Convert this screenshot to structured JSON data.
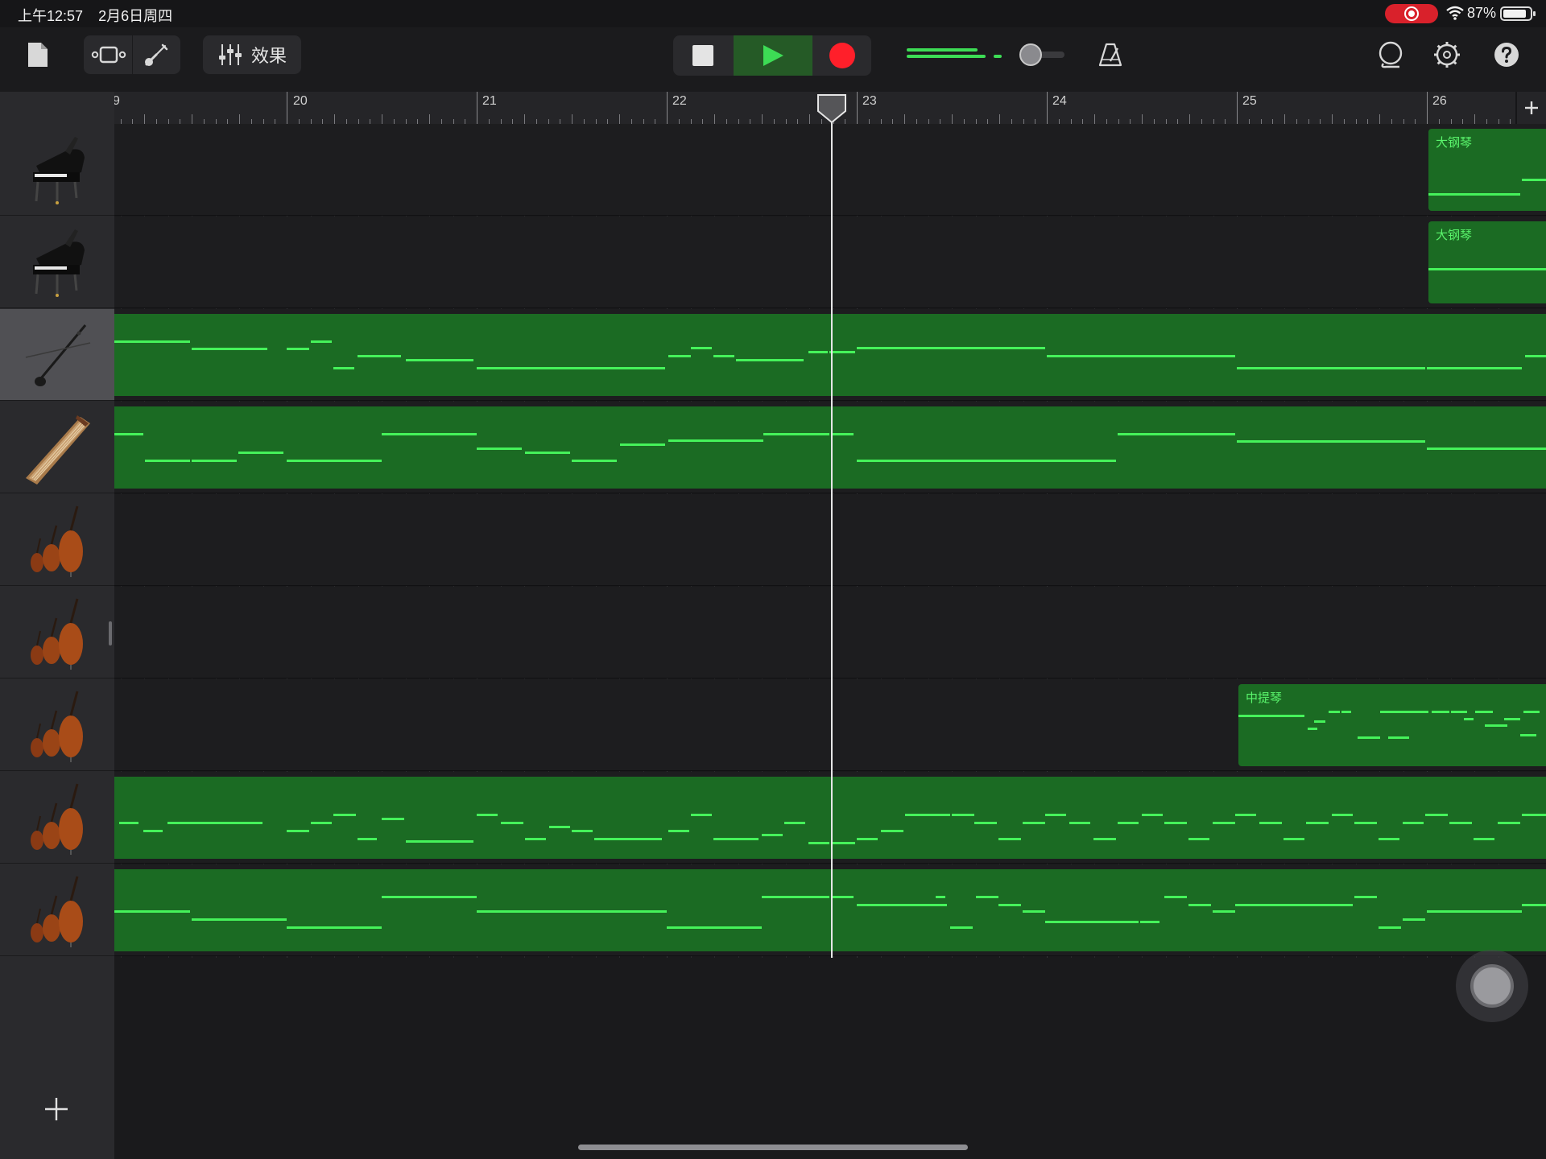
{
  "status_bar": {
    "time": "上午12:57",
    "date": "2月6日周四",
    "battery": "87%",
    "battery_level": 0.87,
    "screen_recording": true
  },
  "toolbar": {
    "effects_label": "效果",
    "volume_level": 0.78,
    "icons": [
      "document-icon",
      "view-toggle-icon",
      "guitar-icon",
      "mixer-sliders-icon",
      "stop-icon",
      "play-icon",
      "record-icon",
      "metronome-icon",
      "loop-icon",
      "settings-gear-icon",
      "help-icon"
    ]
  },
  "ruler": {
    "bars": [
      "20",
      "21",
      "22",
      "23",
      "24",
      "25",
      "26"
    ],
    "partial_left_label": "9",
    "playhead_bar": 22.85
  },
  "colors": {
    "region": "#1b6b23",
    "note": "#45f25a",
    "record": "#ff1f2a",
    "play_active": "#255a26"
  },
  "tracks": [
    {
      "instrument": "grand-piano-icon",
      "selected": false,
      "regions": [
        {
          "name": "大钢琴"
        }
      ]
    },
    {
      "instrument": "grand-piano-icon",
      "selected": false,
      "regions": [
        {
          "name": "大钢琴"
        }
      ]
    },
    {
      "instrument": "erhu-icon",
      "selected": true,
      "regions": [
        {
          "name": ""
        }
      ]
    },
    {
      "instrument": "guzheng-icon",
      "selected": false,
      "regions": [
        {
          "name": ""
        }
      ]
    },
    {
      "instrument": "strings-ensemble-icon",
      "selected": false,
      "regions": []
    },
    {
      "instrument": "strings-ensemble-icon",
      "selected": false,
      "regions": []
    },
    {
      "instrument": "strings-ensemble-icon",
      "selected": false,
      "regions": [
        {
          "name": "中提琴"
        }
      ]
    },
    {
      "instrument": "strings-ensemble-icon",
      "selected": false,
      "regions": [
        {
          "name": ""
        }
      ]
    },
    {
      "instrument": "strings-ensemble-icon",
      "selected": false,
      "regions": [
        {
          "name": ""
        }
      ]
    }
  ]
}
